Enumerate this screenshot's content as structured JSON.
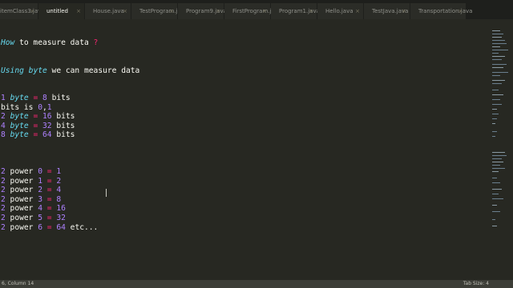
{
  "tabs": [
    {
      "label": "itemClass3.java",
      "active": false
    },
    {
      "label": "untitled",
      "active": true
    },
    {
      "label": "House.java",
      "active": false
    },
    {
      "label": "TestProgram.java",
      "active": false
    },
    {
      "label": "Program9.java",
      "active": false
    },
    {
      "label": "FirstProgram.java",
      "active": false
    },
    {
      "label": "Program1.java",
      "active": false
    },
    {
      "label": "Hello.java",
      "active": false
    },
    {
      "label": "TestJava.java",
      "active": false
    },
    {
      "label": "Transportation.java",
      "active": false
    }
  ],
  "tab_close_glyph": "×",
  "editor": {
    "line1": {
      "a": "How",
      "b": " to measure data ",
      "c": "?"
    },
    "line2": {
      "a": "Using",
      "b": " ",
      "c": "byte",
      "d": " we can measure data"
    },
    "line3": {
      "a": "1",
      "b": " ",
      "c": "byte",
      "d": " ",
      "e": "=",
      "f": " ",
      "g": "8",
      "h": " bits"
    },
    "line4": {
      "a": "bits is ",
      "b": "0",
      "c": ",",
      "d": "1"
    },
    "line5": {
      "a": "2",
      "b": " ",
      "c": "byte",
      "d": " ",
      "e": "=",
      "f": " ",
      "g": "16",
      "h": " bits"
    },
    "line6": {
      "a": "4",
      "b": " ",
      "c": "byte",
      "d": " ",
      "e": "=",
      "f": " ",
      "g": "32",
      "h": " bits"
    },
    "line7": {
      "a": "8",
      "b": " ",
      "c": "byte",
      "d": " ",
      "e": "=",
      "f": " ",
      "g": "64",
      "h": " bits"
    },
    "powers": [
      {
        "base": "2",
        "word": " power ",
        "exp": "0",
        "eq": "=",
        "res": "1",
        "tail": ""
      },
      {
        "base": "2",
        "word": " power ",
        "exp": "1",
        "eq": "=",
        "res": "2",
        "tail": ""
      },
      {
        "base": "2",
        "word": " power ",
        "exp": "2",
        "eq": "=",
        "res": "4",
        "tail": ""
      },
      {
        "base": "2",
        "word": " power ",
        "exp": "3",
        "eq": "=",
        "res": "8",
        "tail": ""
      },
      {
        "base": "2",
        "word": " power ",
        "exp": "4",
        "eq": "=",
        "res": "16",
        "tail": ""
      },
      {
        "base": "2",
        "word": " power ",
        "exp": "5",
        "eq": "=",
        "res": "32",
        "tail": ""
      },
      {
        "base": "2",
        "word": " power ",
        "exp": "6",
        "eq": "=",
        "res": "64",
        "tail": " etc..."
      }
    ]
  },
  "status": {
    "position": "6, Column 14",
    "tab_size": "Tab Size: 4"
  },
  "colors": {
    "background": "#272822",
    "keyword": "#66d9ef",
    "number": "#ae81ff",
    "operator": "#f92672",
    "text": "#f8f8f2"
  }
}
